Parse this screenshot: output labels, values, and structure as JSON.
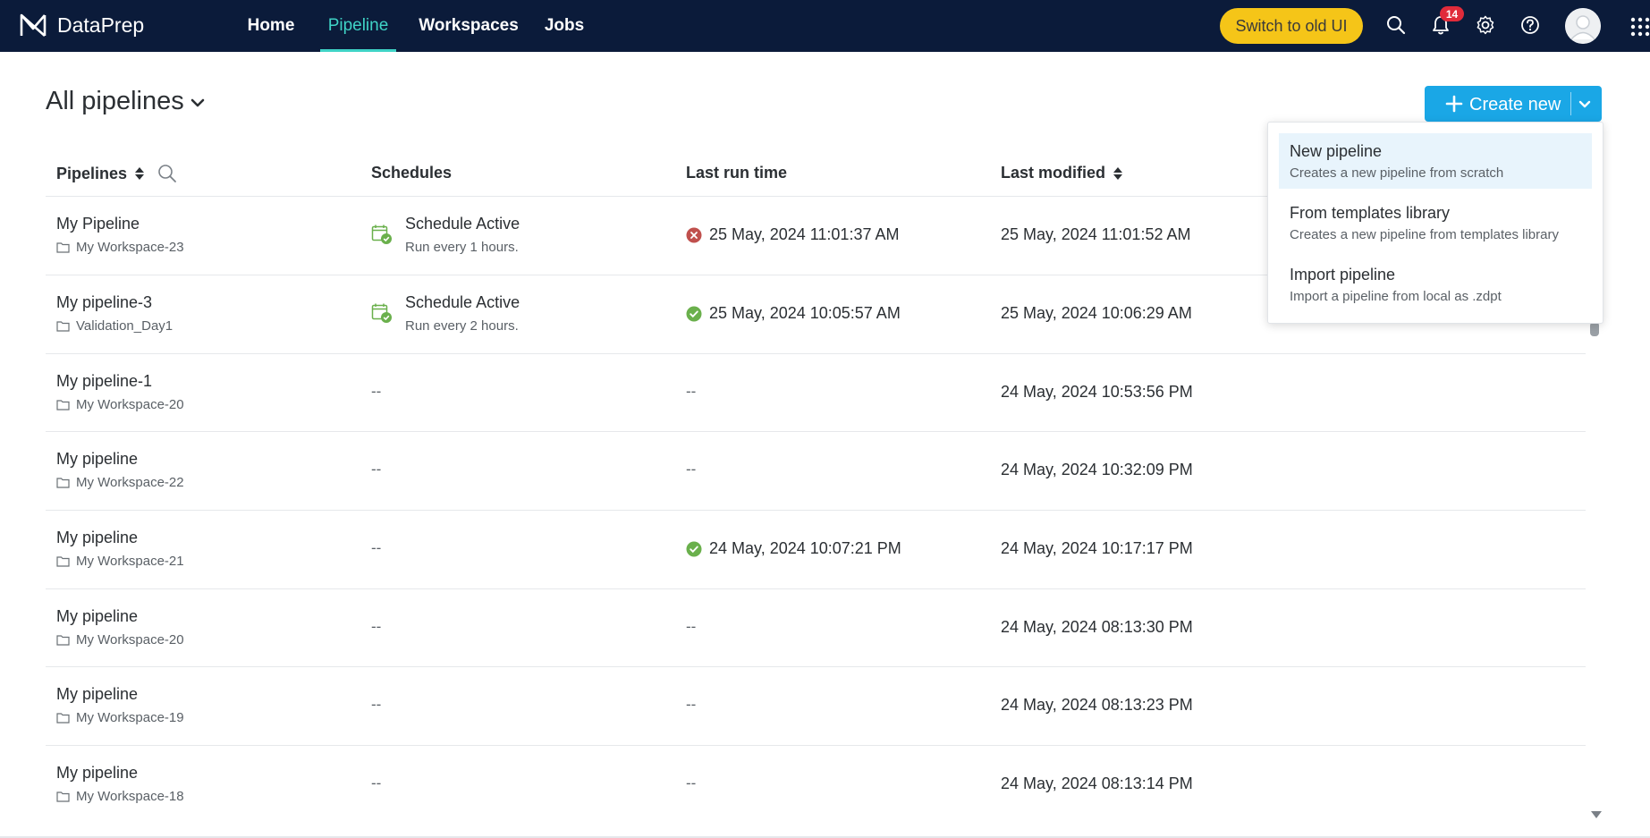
{
  "app": {
    "name": "DataPrep"
  },
  "nav": {
    "items": [
      "Home",
      "Pipeline",
      "Workspaces",
      "Jobs"
    ],
    "active": "Pipeline"
  },
  "topbar": {
    "switch_label": "Switch to old UI",
    "notification_count": "14"
  },
  "page": {
    "title": "All pipelines",
    "create_label": "Create new"
  },
  "table": {
    "headers": {
      "pipelines": "Pipelines",
      "schedules": "Schedules",
      "last_run": "Last run time",
      "last_modified": "Last modified"
    },
    "rows": [
      {
        "name": "My Pipeline",
        "workspace": "My Workspace-23",
        "schedule_title": "Schedule Active",
        "schedule_sub": "Run every 1 hours.",
        "run_status": "failed",
        "last_run": "25 May, 2024 11:01:37 AM",
        "last_modified": "25 May, 2024 11:01:52 AM"
      },
      {
        "name": "My pipeline-3",
        "workspace": "Validation_Day1",
        "schedule_title": "Schedule Active",
        "schedule_sub": "Run every 2 hours.",
        "run_status": "success",
        "last_run": "25 May, 2024 10:05:57 AM",
        "last_modified": "25 May, 2024 10:06:29 AM"
      },
      {
        "name": "My pipeline-1",
        "workspace": "My Workspace-20",
        "schedule_title": "--",
        "schedule_sub": "",
        "run_status": "none",
        "last_run": "--",
        "last_modified": "24 May, 2024 10:53:56 PM"
      },
      {
        "name": "My pipeline",
        "workspace": "My Workspace-22",
        "schedule_title": "--",
        "schedule_sub": "",
        "run_status": "none",
        "last_run": "--",
        "last_modified": "24 May, 2024 10:32:09 PM"
      },
      {
        "name": "My pipeline",
        "workspace": "My Workspace-21",
        "schedule_title": "--",
        "schedule_sub": "",
        "run_status": "success",
        "last_run": "24 May, 2024 10:07:21 PM",
        "last_modified": "24 May, 2024 10:17:17 PM"
      },
      {
        "name": "My pipeline",
        "workspace": "My Workspace-20",
        "schedule_title": "--",
        "schedule_sub": "",
        "run_status": "none",
        "last_run": "--",
        "last_modified": "24 May, 2024 08:13:30 PM"
      },
      {
        "name": "My pipeline",
        "workspace": "My Workspace-19",
        "schedule_title": "--",
        "schedule_sub": "",
        "run_status": "none",
        "last_run": "--",
        "last_modified": "24 May, 2024 08:13:23 PM"
      },
      {
        "name": "My pipeline",
        "workspace": "My Workspace-18",
        "schedule_title": "--",
        "schedule_sub": "",
        "run_status": "none",
        "last_run": "--",
        "last_modified": "24 May, 2024 08:13:14 PM"
      }
    ]
  },
  "create_menu": {
    "items": [
      {
        "title": "New pipeline",
        "desc": "Creates a new pipeline from scratch"
      },
      {
        "title": "From templates library",
        "desc": "Creates a new pipeline from templates library"
      },
      {
        "title": "Import pipeline",
        "desc": "Import a pipeline from local as .zdpt"
      }
    ]
  },
  "colors": {
    "topbar": "#0b1b3a",
    "accent_nav": "#3fd3c6",
    "switch": "#f5c518",
    "primary": "#1aa7e6",
    "success": "#6ab04c",
    "error": "#c0504d",
    "badge": "#e02b3a"
  },
  "icons": [
    "logo-icon",
    "search-icon",
    "bell-icon",
    "gear-icon",
    "help-icon",
    "avatar-icon",
    "apps-grid-icon",
    "chevron-down-icon",
    "plus-icon",
    "sort-icon",
    "folder-icon",
    "calendar-check-icon",
    "success-icon",
    "error-icon"
  ]
}
